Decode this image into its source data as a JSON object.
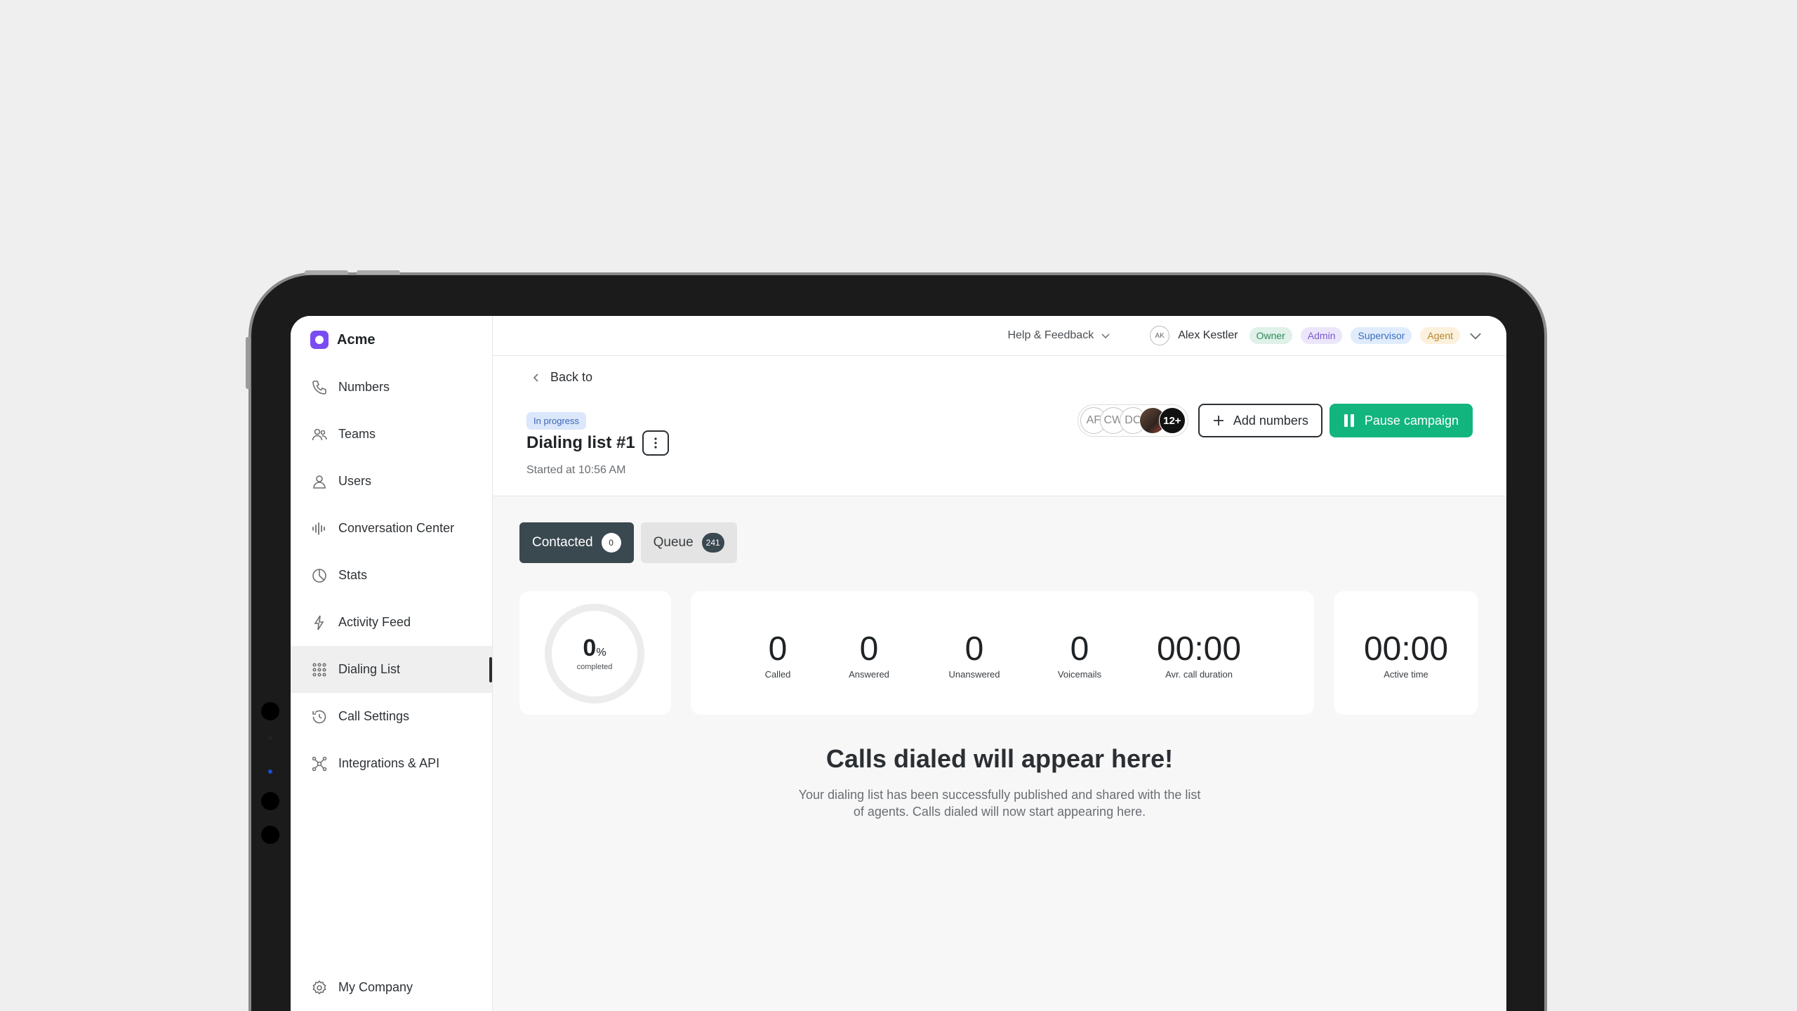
{
  "brand": {
    "name": "Acme"
  },
  "sidebar": {
    "items": [
      {
        "label": "Numbers",
        "icon": "phone-icon"
      },
      {
        "label": "Teams",
        "icon": "team-icon"
      },
      {
        "label": "Users",
        "icon": "user-icon"
      },
      {
        "label": "Conversation Center",
        "icon": "waveform-icon"
      },
      {
        "label": "Stats",
        "icon": "pie-chart-icon"
      },
      {
        "label": "Activity Feed",
        "icon": "lightning-icon"
      },
      {
        "label": "Dialing List",
        "icon": "dial-grid-icon",
        "active": true
      },
      {
        "label": "Call Settings",
        "icon": "history-icon"
      },
      {
        "label": "Integrations & API",
        "icon": "integrations-icon"
      }
    ],
    "bottom_item": {
      "label": "My Company",
      "icon": "gear-icon"
    }
  },
  "topbar": {
    "help_label": "Help & Feedback",
    "user": {
      "initials": "AK",
      "name": "Alex Kestler",
      "roles": [
        "Owner",
        "Admin",
        "Supervisor",
        "Agent"
      ]
    }
  },
  "header": {
    "back_label": "Back to",
    "status": "In progress",
    "title": "Dialing list #1",
    "started": "Started at 10:56 AM",
    "agents": [
      "AF",
      "CW",
      "DC"
    ],
    "agents_more": "12+",
    "add_numbers_label": "Add numbers",
    "pause_label": "Pause campaign"
  },
  "tabs": [
    {
      "label": "Contacted",
      "count": "0"
    },
    {
      "label": "Queue",
      "count": "241"
    }
  ],
  "progress": {
    "value": "0",
    "unit": "%",
    "label": "completed",
    "fraction": 0
  },
  "stats": [
    {
      "value": "0",
      "label": "Called"
    },
    {
      "value": "0",
      "label": "Answered"
    },
    {
      "value": "0",
      "label": "Unanswered"
    },
    {
      "value": "0",
      "label": "Voicemails"
    },
    {
      "value": "00:00",
      "label": "Avr. call duration"
    }
  ],
  "active_time": {
    "value": "00:00",
    "label": "Active time"
  },
  "empty_state": {
    "title": "Calls dialed will appear here!",
    "description": "Your dialing list has been successfully published and shared with the list of agents. Calls dialed will now start appearing here."
  },
  "colors": {
    "accent": "#12b57d",
    "brand": "#7a4cf3",
    "tab_active": "#3a4850"
  }
}
